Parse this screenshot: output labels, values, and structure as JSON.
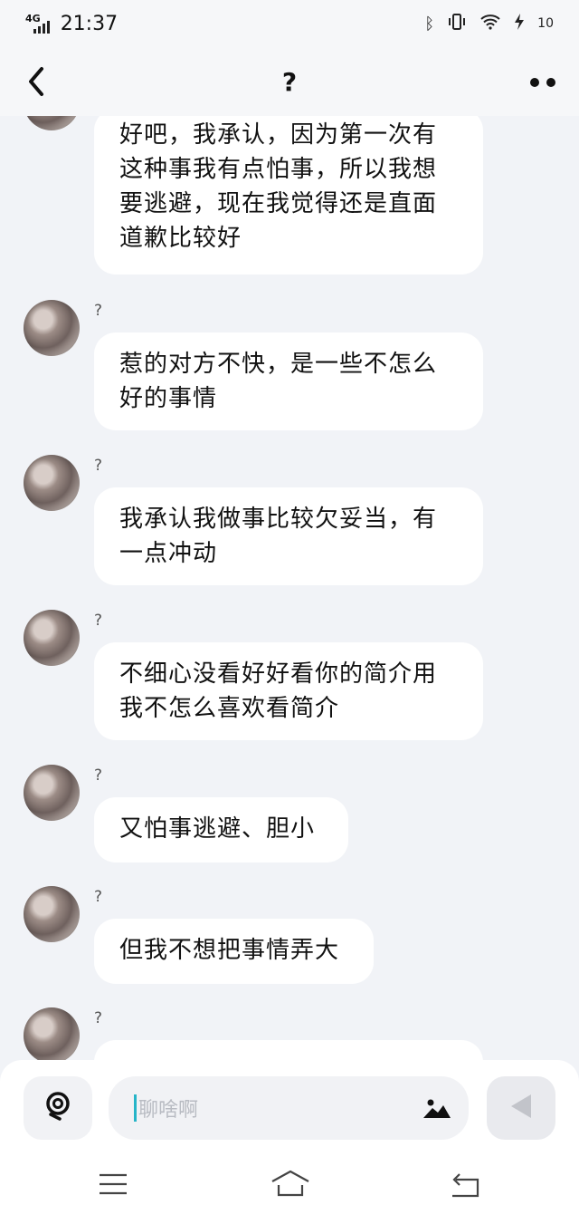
{
  "status": {
    "network": "4G",
    "time": "21:37",
    "battery": "10"
  },
  "header": {
    "title": "?"
  },
  "messages": [
    {
      "nick": "",
      "text": "好吧，我承认，因为第一次有这种事我有点怕事，所以我想要逃避，现在我觉得还是直面道歉比较好"
    },
    {
      "nick": "?",
      "text": "惹的对方不快，是一些不怎么好的事情"
    },
    {
      "nick": "?",
      "text": "我承认我做事比较欠妥当，有一点冲动"
    },
    {
      "nick": "?",
      "text": "不细心没看好好看你的简介用我不怎么喜欢看简介"
    },
    {
      "nick": "?",
      "text": "又怕事逃避、胆小"
    },
    {
      "nick": "?",
      "text": "但我不想把事情弄大"
    },
    {
      "nick": "?",
      "text": ""
    }
  ],
  "input": {
    "placeholder": "聊啥啊"
  },
  "icons": {
    "back": "back-chevron-icon",
    "more": "more-dots-icon",
    "voice": "voice-icon",
    "image": "image-icon",
    "send": "send-icon",
    "nav_menu": "menu-icon",
    "nav_home": "home-icon",
    "nav_back": "back-icon"
  }
}
